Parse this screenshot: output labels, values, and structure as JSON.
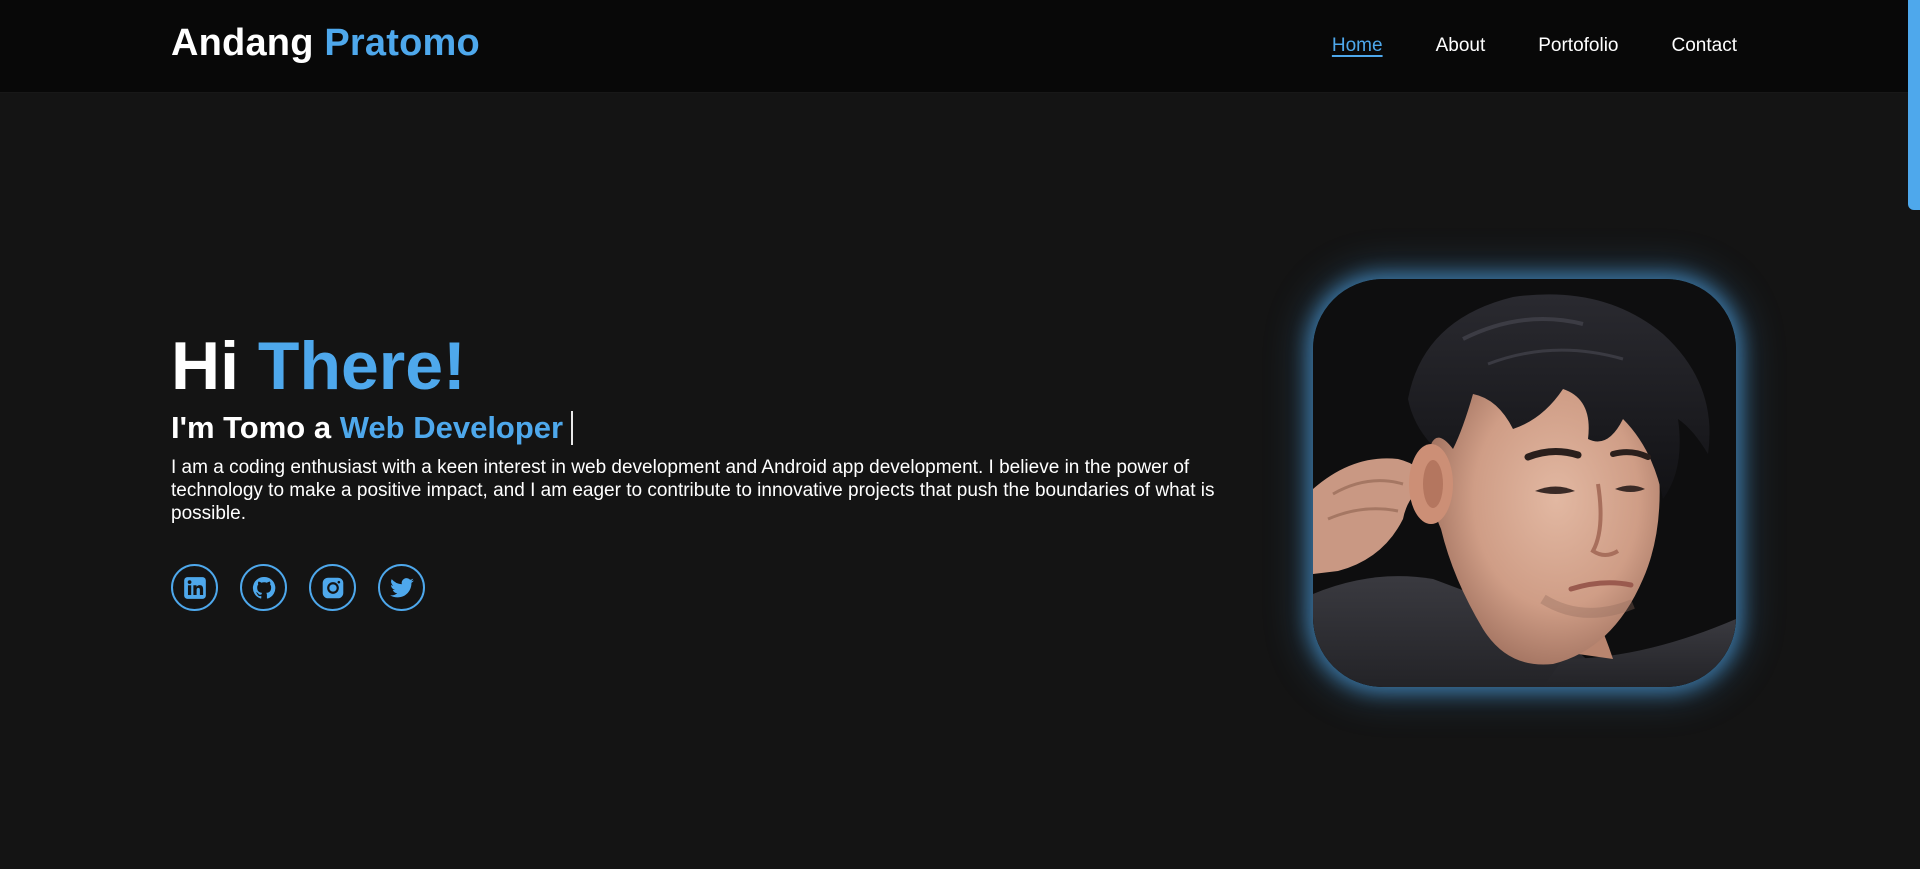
{
  "header": {
    "logo_first": "Andang",
    "logo_second": "Pratomo",
    "nav": [
      {
        "label": "Home",
        "active": true
      },
      {
        "label": "About",
        "active": false
      },
      {
        "label": "Portofolio",
        "active": false
      },
      {
        "label": "Contact",
        "active": false
      }
    ]
  },
  "hero": {
    "greeting_plain": "Hi",
    "greeting_accent": "There!",
    "subtitle_plain": "I'm Tomo a",
    "subtitle_accent": "Web Developer",
    "description": "I am a coding enthusiast with a keen interest in web development and Android app development. I believe in the power of technology to make a positive impact, and I am eager to contribute to innovative projects that push the boundaries of what is possible.",
    "socials": [
      {
        "icon": "linkedin-icon"
      },
      {
        "icon": "github-icon"
      },
      {
        "icon": "instagram-icon"
      },
      {
        "icon": "twitter-icon"
      }
    ]
  },
  "colors": {
    "accent": "#4ea8ec",
    "background": "#141414",
    "header_background": "#080808",
    "text": "#ffffff"
  }
}
